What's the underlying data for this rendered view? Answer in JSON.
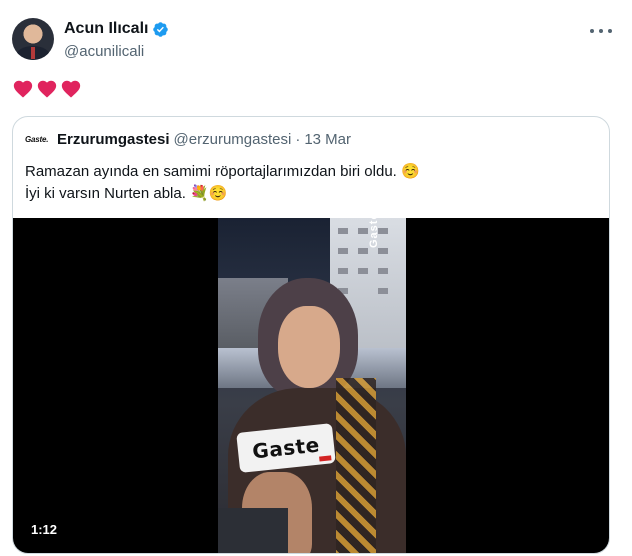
{
  "author": {
    "display_name": "Acun Ilıcalı",
    "handle": "@acunilicali",
    "avatar_icon": "user-avatar",
    "verified_icon": "verified-badge-icon",
    "verified_color": "#1d9bf0"
  },
  "tweet": {
    "hearts": [
      "red-heart-icon",
      "red-heart-icon",
      "red-heart-icon"
    ],
    "heart_color": "#e0245e"
  },
  "quote": {
    "logo_text": "Gaste.",
    "display_name": "Erzurumgastesi",
    "handle": "@erzurumgastesi",
    "separator": "·",
    "time": "13 Mar",
    "text_line1": "Ramazan ayında en samimi röportajlarımızdan biri oldu. ☺️",
    "text_line2": "İyi ki varsın Nurten abla. 💐☺️",
    "video": {
      "duration": "1:12",
      "mic_text": "Gaste",
      "watermark": "Gaste"
    }
  },
  "menu": {
    "icon": "more-options-icon"
  }
}
